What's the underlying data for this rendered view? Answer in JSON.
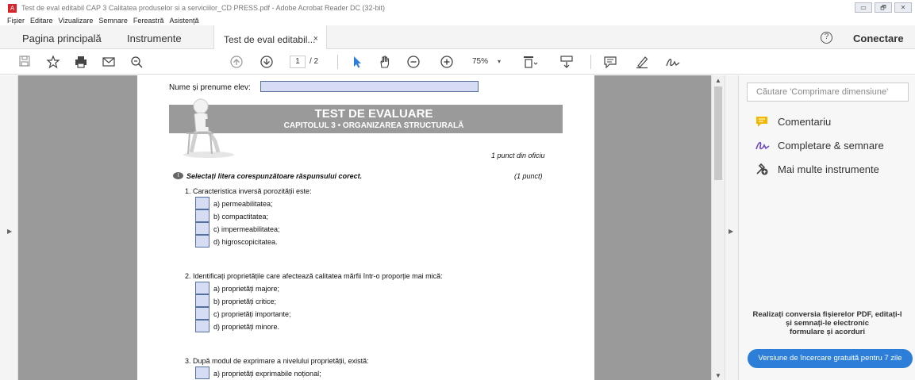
{
  "window": {
    "title": "Test de eval editabil CAP 3 Calitatea produselor si a serviciilor_CD PRESS.pdf - Adobe Acrobat Reader DC (32-bit)",
    "controls": [
      "▭",
      "🗗",
      "✕"
    ]
  },
  "menu": [
    "Fișier",
    "Editare",
    "Vizualizare",
    "Semnare",
    "Fereastră",
    "Asistență"
  ],
  "tabs": {
    "home": "Pagina principală",
    "tools": "Instrumente",
    "document": "Test de eval editabil...",
    "close": "×",
    "help": "?",
    "connect": "Conectare"
  },
  "toolbar": {
    "page_current": "1",
    "page_total": "/ 2",
    "zoom": "75%",
    "zoom_arrow": "▾"
  },
  "document": {
    "name_label": "Nume și prenume elev:",
    "banner_title": "TEST DE EVALUARE",
    "banner_subtitle": "CAPITOLUL 3 • ORGANIZAREA STRUCTURALĂ",
    "points_office": "1 punct din oficiu",
    "section_number": "I",
    "section_instruction": "Selectați litera corespunzătoare răspunsului corect.",
    "section_points": "(1 punct)",
    "q1": {
      "text": "1. Caracteristica inversă porozității este:",
      "options": [
        "a) permeabilitatea;",
        "b) compactitatea;",
        "c)  impermeabilitatea;",
        "d) higroscopicitatea."
      ]
    },
    "q2": {
      "text": "2. Identificați proprietățile care afectează calitatea mărfii într-o proporție mai mică:",
      "options": [
        "a) proprietăți majore;",
        "b) proprietăți critice;",
        "c) proprietăți importante;",
        "d) proprietăți minore."
      ]
    },
    "q3": {
      "text": "3. După modul de exprimare a nivelului proprietății, există:",
      "options": [
        "a) proprietăți exprimabile noțional;"
      ]
    }
  },
  "right_pane": {
    "search_placeholder": "Căutare 'Comprimare dimensiune'",
    "items": [
      "Comentariu",
      "Completare & semnare",
      "Mai multe instrumente"
    ],
    "promo": [
      "Realizați conversia fișierelor PDF, editați-l",
      "și semnați-le electronic",
      "formulare și acorduri"
    ],
    "trial_button": "Versiune de încercare gratuită pentru 7 zile"
  },
  "colors": {
    "accent": "#2d7ed8",
    "comment_icon": "#f0b800",
    "sign_icon": "#6b4bc8",
    "form_field": "#d6dcf4"
  }
}
